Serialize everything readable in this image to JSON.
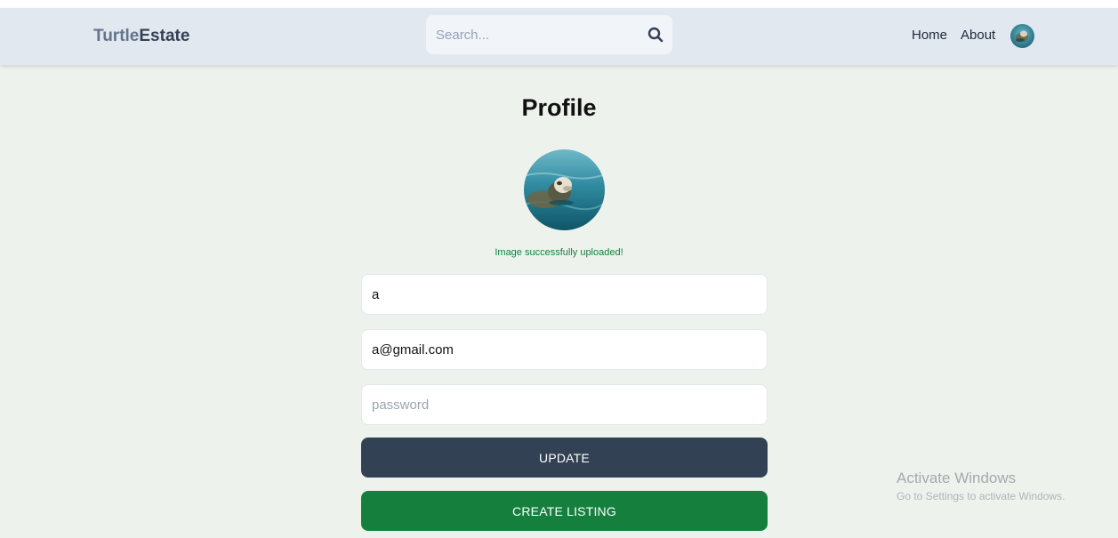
{
  "navbar": {
    "brand_part1": "Turtle",
    "brand_part2": "Estate",
    "search_placeholder": "Search...",
    "search_icon": "search-icon",
    "links": [
      "Home",
      "About"
    ],
    "avatar_icon": "user-avatar"
  },
  "profile": {
    "title": "Profile",
    "upload_message": "Image successfully uploaded!",
    "username_value": "a",
    "email_value": "a@gmail.com",
    "password_placeholder": "password",
    "update_label": "UPDATE",
    "create_listing_label": "CREATE LISTING"
  },
  "os_watermark": {
    "title": "Activate Windows",
    "subtitle": "Go to Settings to activate Windows."
  },
  "colors": {
    "navbar_bg": "#e2e8f0",
    "page_bg": "#eef2ed",
    "update_button": "#334155",
    "create_button": "#15803d",
    "success_text": "#15803d"
  }
}
